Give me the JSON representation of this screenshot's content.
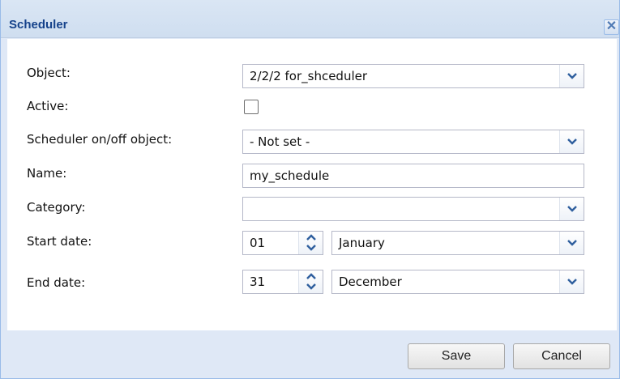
{
  "dialog": {
    "title": "Scheduler",
    "close_label": "✕"
  },
  "form": {
    "object": {
      "label": "Object:",
      "value": "2/2/2 for_shceduler"
    },
    "active": {
      "label": "Active:",
      "checked": false
    },
    "onoff": {
      "label": "Scheduler on/off object:",
      "value": "- Not set -"
    },
    "name": {
      "label": "Name:",
      "value": "my_schedule"
    },
    "category": {
      "label": "Category:",
      "value": ""
    },
    "start_date": {
      "label": "Start date:",
      "day": "01",
      "month": "January"
    },
    "end_date": {
      "label": "End date:",
      "day": "31",
      "month": "December"
    }
  },
  "buttons": {
    "save": "Save",
    "cancel": "Cancel"
  },
  "icons": {
    "close": "close-icon",
    "dropdown": "chevron-down-icon",
    "spin_up": "spin-up-icon",
    "spin_down": "spin-down-icon"
  },
  "colors": {
    "title_text": "#15428b",
    "window_bg": "#dfe8f6",
    "field_border": "#b5b8c8",
    "trigger_arrow": "#2f5f9e"
  }
}
